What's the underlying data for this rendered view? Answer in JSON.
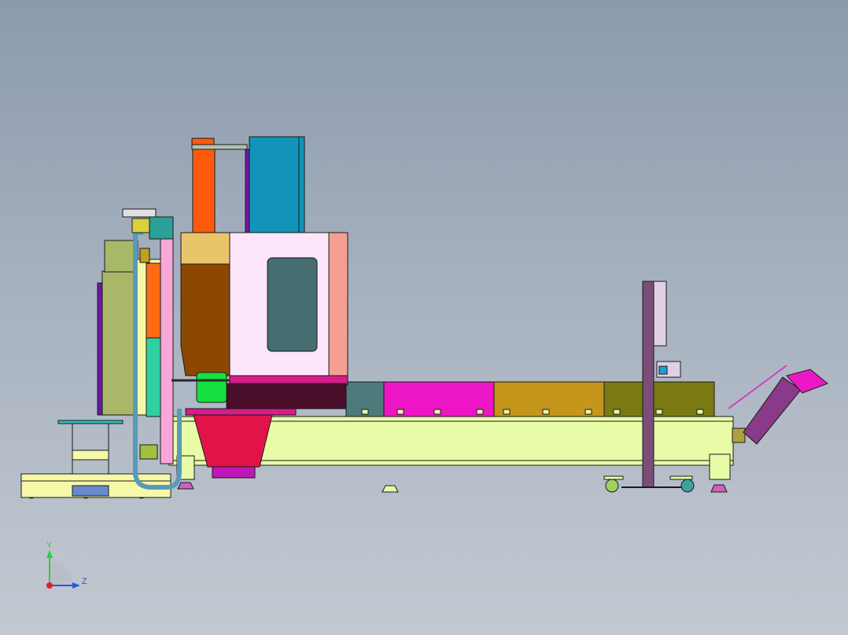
{
  "viewport": {
    "background_top": "#8c9aad",
    "background_bottom": "#c3c9d1"
  },
  "triad": {
    "y_label": "Y",
    "z_label": "Z",
    "y_color": "#2ecc40",
    "z_color": "#1f5fe0",
    "origin_color": "#e0202a"
  },
  "colors": {
    "base_frame": "#e8fca8",
    "enclosure": "#fde6fa",
    "enclosure_window": "#456d72",
    "teal_cabinet": "#1293b8",
    "orange_column": "#ff5a0c",
    "hopper": "#e01448",
    "conveyor_magenta": "#ec16c4",
    "conveyor_gold": "#c4961c",
    "conveyor_olive": "#7a7a14",
    "conveyor_teal": "#4d7a7a",
    "chip_chute": "#ec18c8",
    "chip_auger": "#8a3a88",
    "brown_panel": "#8d4800",
    "post": "#7a4e78",
    "olive_panel": "#a8b868",
    "green_box": "#18e040",
    "rail": "#2ec0c0"
  },
  "components": [
    "base-frame",
    "machining-enclosure",
    "electrical-cabinet",
    "spindle-column",
    "coolant-hopper",
    "chip-conveyor",
    "chip-auger",
    "operator-platform",
    "coolant-hose",
    "support-post",
    "caster-wheels"
  ]
}
